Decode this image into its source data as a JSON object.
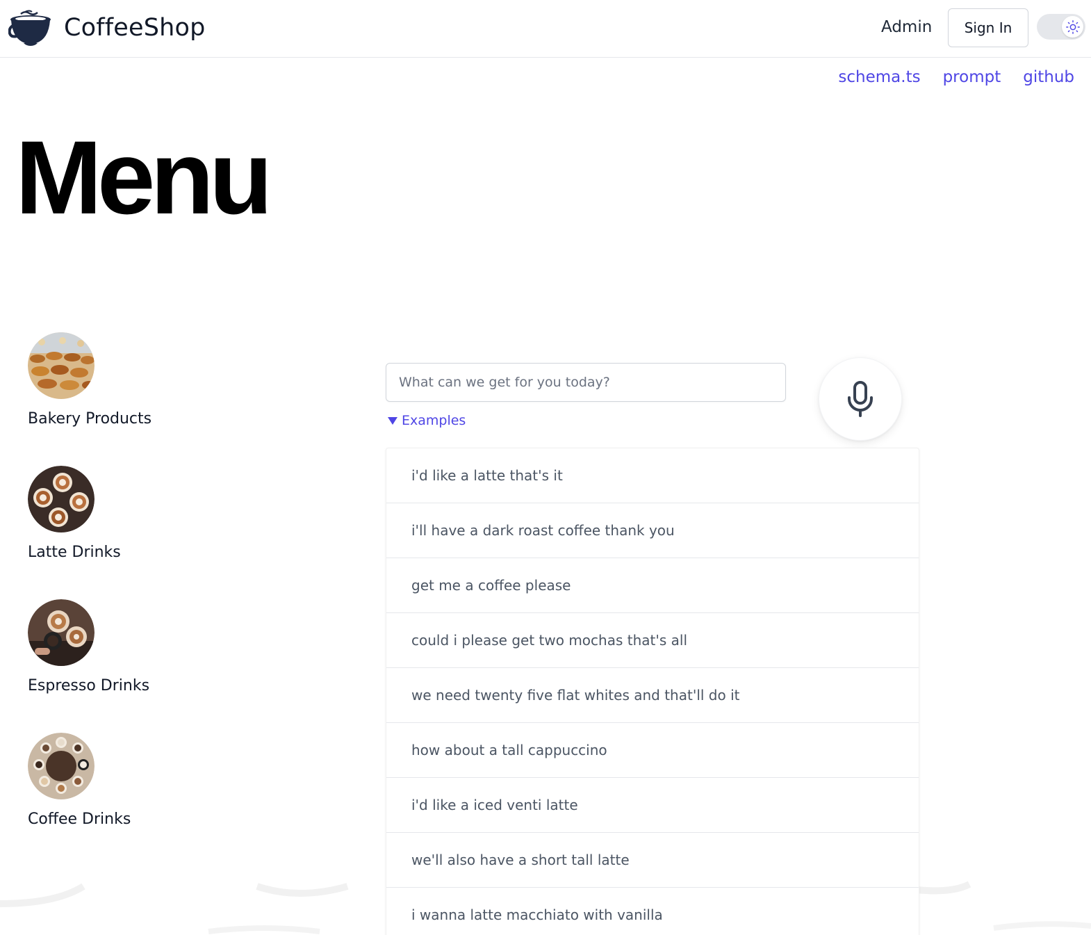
{
  "header": {
    "brand": "CoffeeShop",
    "admin_label": "Admin",
    "signin_label": "Sign In",
    "theme_icon": "sun-icon"
  },
  "top_links": [
    "schema.ts",
    "prompt",
    "github"
  ],
  "title": "Menu",
  "categories": [
    {
      "label": "Bakery Products",
      "icon": "bakery-image"
    },
    {
      "label": "Latte Drinks",
      "icon": "latte-image"
    },
    {
      "label": "Espresso Drinks",
      "icon": "espresso-image"
    },
    {
      "label": "Coffee Drinks",
      "icon": "coffee-image"
    }
  ],
  "order": {
    "placeholder": "What can we get for you today?",
    "value": ""
  },
  "examples": {
    "toggle_label": "Examples",
    "items": [
      "i'd like a latte that's it",
      "i'll have a dark roast coffee thank you",
      "get me a coffee please",
      "could i please get two mochas that's all",
      "we need twenty five flat whites and that'll do it",
      "how about a tall cappuccino",
      "i'd like a iced venti latte",
      "we'll also have a short tall latte",
      "i wanna latte macchiato with vanilla"
    ]
  },
  "colors": {
    "accent": "#4f46e5",
    "logo": "#1e2a44"
  }
}
